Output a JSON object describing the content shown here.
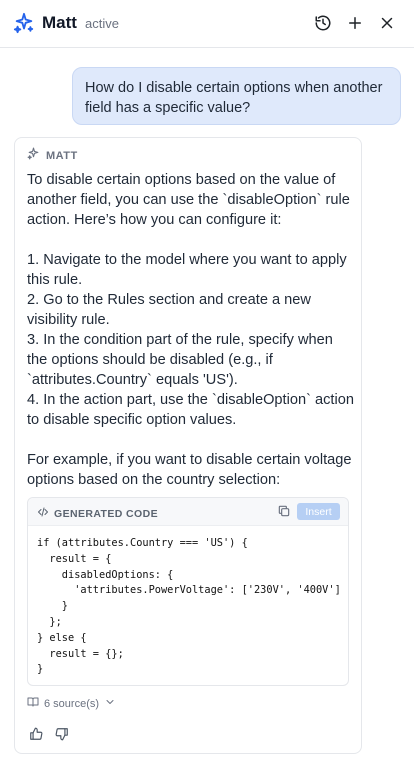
{
  "header": {
    "title": "Matt",
    "status": "active",
    "icons": [
      "sparkle-icon",
      "history-icon",
      "plus-icon",
      "close-icon"
    ]
  },
  "conversation": {
    "user_message": "How do I disable certain options when another field has a specific value?",
    "assistant": {
      "name": "MATT",
      "paragraphs": [
        "To disable certain options based on the value of another field, you can use the `disableOption` rule action. Here’s how you can configure it:",
        "",
        "1. Navigate to the model where you want to apply this rule.",
        "2. Go to the Rules section and create a new visibility rule.",
        "3. In the condition part of the rule, specify when the options should be disabled (e.g., if `attributes.Country` equals 'US').",
        "4. In the action part, use the `disableOption` action to disable specific option values.",
        "",
        "For example, if you want to disable certain voltage options based on the country selection:"
      ],
      "code_block": {
        "label": "GENERATED CODE",
        "insert_label": "Insert",
        "code": "if (attributes.Country === 'US') {\n  result = {\n    disabledOptions: {\n      'attributes.PowerVoltage': ['230V', '400V']\n    }\n  };\n} else {\n  result = {};\n}"
      },
      "sources_label": "6 source(s)"
    }
  },
  "colors": {
    "accent": "#2563eb",
    "user_bubble": "#dfe9fb",
    "insert_button": "#b6cff4"
  }
}
